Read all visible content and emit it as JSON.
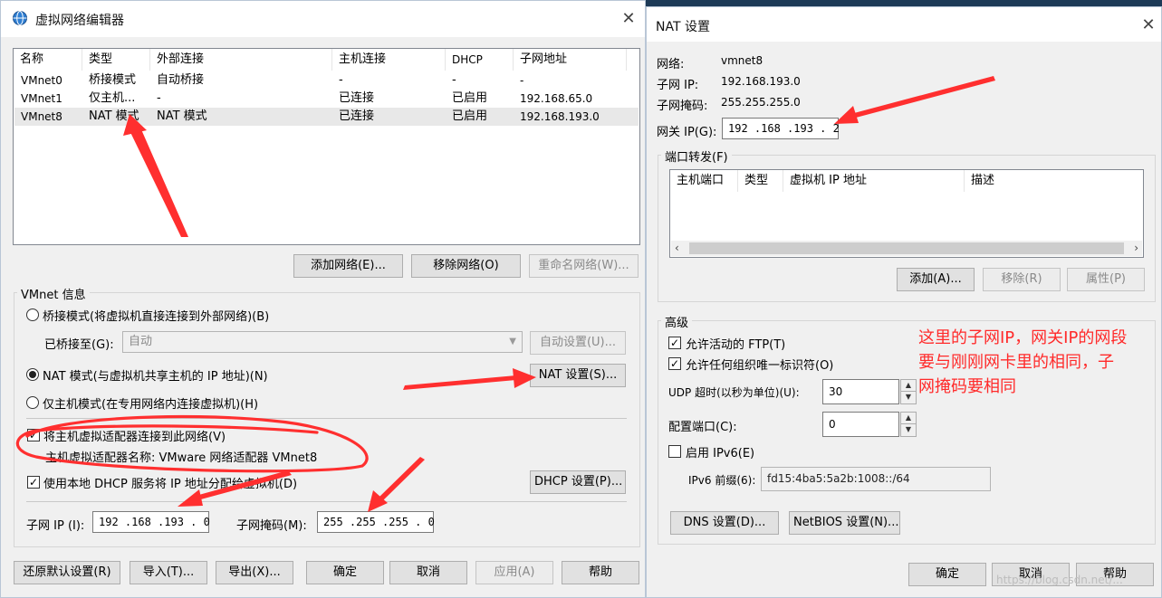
{
  "left_window": {
    "title": "虚拟网络编辑器",
    "columns": [
      "名称",
      "类型",
      "外部连接",
      "主机连接",
      "DHCP",
      "子网地址"
    ],
    "rows": [
      [
        "VMnet0",
        "桥接模式",
        "自动桥接",
        "-",
        "-",
        "-"
      ],
      [
        "VMnet1",
        "仅主机...",
        "-",
        "已连接",
        "已启用",
        "192.168.65.0"
      ],
      [
        "VMnet8",
        "NAT 模式",
        "NAT 模式",
        "已连接",
        "已启用",
        "192.168.193.0"
      ]
    ],
    "add_network": "添加网络(E)...",
    "remove_network": "移除网络(O)",
    "rename_network": "重命名网络(W)...",
    "vmnet_info_title": "VMnet 信息",
    "radio_bridge": "桥接模式(将虚拟机直接连接到外部网络)(B)",
    "bridged_to_label": "已桥接至(G):",
    "bridged_to_value": "自动",
    "auto_settings": "自动设置(U)...",
    "radio_nat": "NAT 模式(与虚拟机共享主机的 IP 地址)(N)",
    "nat_settings": "NAT 设置(S)...",
    "radio_host_only": "仅主机模式(在专用网络内连接虚拟机)(H)",
    "connect_adapter": "将主机虚拟适配器连接到此网络(V)",
    "adapter_name": "主机虚拟适配器名称: VMware 网络适配器 VMnet8",
    "use_dhcp": "使用本地 DHCP 服务将 IP 地址分配给虚拟机(D)",
    "dhcp_settings": "DHCP 设置(P)...",
    "subnet_ip_label": "子网 IP (I):",
    "subnet_ip_value": "192 .168 .193 . 0",
    "subnet_mask_label": "子网掩码(M):",
    "subnet_mask_value": "255 .255 .255 . 0",
    "restore_defaults": "还原默认设置(R)",
    "import": "导入(T)...",
    "export": "导出(X)...",
    "ok": "确定",
    "cancel": "取消",
    "apply": "应用(A)",
    "help": "帮助"
  },
  "right_window": {
    "title": "NAT 设置",
    "network_label": "网络:",
    "network_value": "vmnet8",
    "subnet_ip_label": "子网 IP:",
    "subnet_ip_value": "192.168.193.0",
    "subnet_mask_label": "子网掩码:",
    "subnet_mask_value": "255.255.255.0",
    "gateway_label": "网关 IP(G):",
    "gateway_value": "192 .168 .193 . 2",
    "port_forward_title": "端口转发(F)",
    "pf_columns": [
      "主机端口",
      "类型",
      "虚拟机 IP 地址",
      "描述"
    ],
    "add": "添加(A)...",
    "remove": "移除(R)",
    "properties": "属性(P)",
    "advanced_title": "高级",
    "allow_ftp": "允许活动的 FTP(T)",
    "allow_org_id": "允许任何组织唯一标识符(O)",
    "udp_timeout_label": "UDP 超时(以秒为单位)(U):",
    "udp_timeout_value": "30",
    "config_port_label": "配置端口(C):",
    "config_port_value": "0",
    "enable_ipv6": "启用 IPv6(E)",
    "ipv6_prefix_label": "IPv6 前缀(6):",
    "ipv6_prefix_value": "fd15:4ba5:5a2b:1008::/64",
    "dns_settings": "DNS 设置(D)...",
    "netbios_settings": "NetBIOS 设置(N)...",
    "ok": "确定",
    "cancel": "取消",
    "help": "帮助"
  },
  "annotation": {
    "lines": [
      "这里的子网IP，网关IP的网段",
      "要与刚刚网卡里的相同，子",
      "网掩码要相同"
    ],
    "color": "#ff2a2a"
  },
  "watermark": "https://blog.csdn.net/..."
}
